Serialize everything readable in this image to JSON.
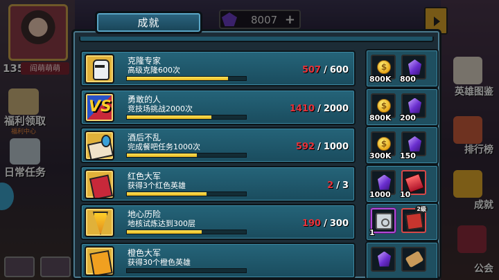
{
  "panel_title": "成就",
  "background": {
    "player_level": "135",
    "player_name": "阎萌萌萌",
    "gem_balance": "8007",
    "left_menu": [
      {
        "label": "福利领取",
        "sub": "福利中心"
      },
      {
        "label": "日常任务",
        "sub": ""
      }
    ],
    "right_menu": [
      {
        "label": "英雄图鉴"
      },
      {
        "label": "排行榜"
      },
      {
        "label": "成就"
      },
      {
        "label": "公会"
      }
    ]
  },
  "achievements": [
    {
      "name": "克隆专家",
      "desc": "高级克隆600次",
      "icon": "robot-icon",
      "current": "507",
      "total": "600",
      "progress": 0.845,
      "rewards": [
        {
          "type": "coin-icon",
          "amount": "800K"
        },
        {
          "type": "gem-icon",
          "amount": "800"
        }
      ]
    },
    {
      "name": "勇敢的人",
      "desc": "竞技场挑战2000次",
      "icon": "vs-icon",
      "icon_text": "VS",
      "current": "1410",
      "total": "2000",
      "progress": 0.705,
      "rewards": [
        {
          "type": "coin-icon",
          "amount": "800K"
        },
        {
          "type": "gem-icon",
          "amount": "200"
        }
      ]
    },
    {
      "name": "酒后不乱",
      "desc": "完成餐吧任务1000次",
      "icon": "pinned-note-icon",
      "current": "592",
      "total": "1000",
      "progress": 0.592,
      "rewards": [
        {
          "type": "coin-icon",
          "amount": "300K"
        },
        {
          "type": "gem-icon",
          "amount": "150"
        }
      ]
    },
    {
      "name": "红色大军",
      "desc": "获得3个红色英雄",
      "icon": "red-cards-icon",
      "current": "2",
      "total": "3",
      "progress": 0.667,
      "rewards": [
        {
          "type": "gem-icon",
          "amount": "1000"
        },
        {
          "type": "red-item-icon",
          "amount": "10"
        }
      ]
    },
    {
      "name": "地心历险",
      "desc": "地核试炼达到300层",
      "icon": "drill-icon",
      "current": "190",
      "total": "300",
      "progress": 0.633,
      "rewards": [
        {
          "type": "safe-icon",
          "amount": "1"
        },
        {
          "type": "book-icon",
          "amount": "",
          "badge": "2级"
        }
      ]
    },
    {
      "name": "橙色大军",
      "desc": "获得30个橙色英雄",
      "icon": "orange-cards-icon",
      "current": "",
      "total": "",
      "progress": 0.0,
      "rewards": [
        {
          "type": "gem-icon",
          "amount": ""
        },
        {
          "type": "scroll-icon",
          "amount": ""
        }
      ]
    }
  ]
}
